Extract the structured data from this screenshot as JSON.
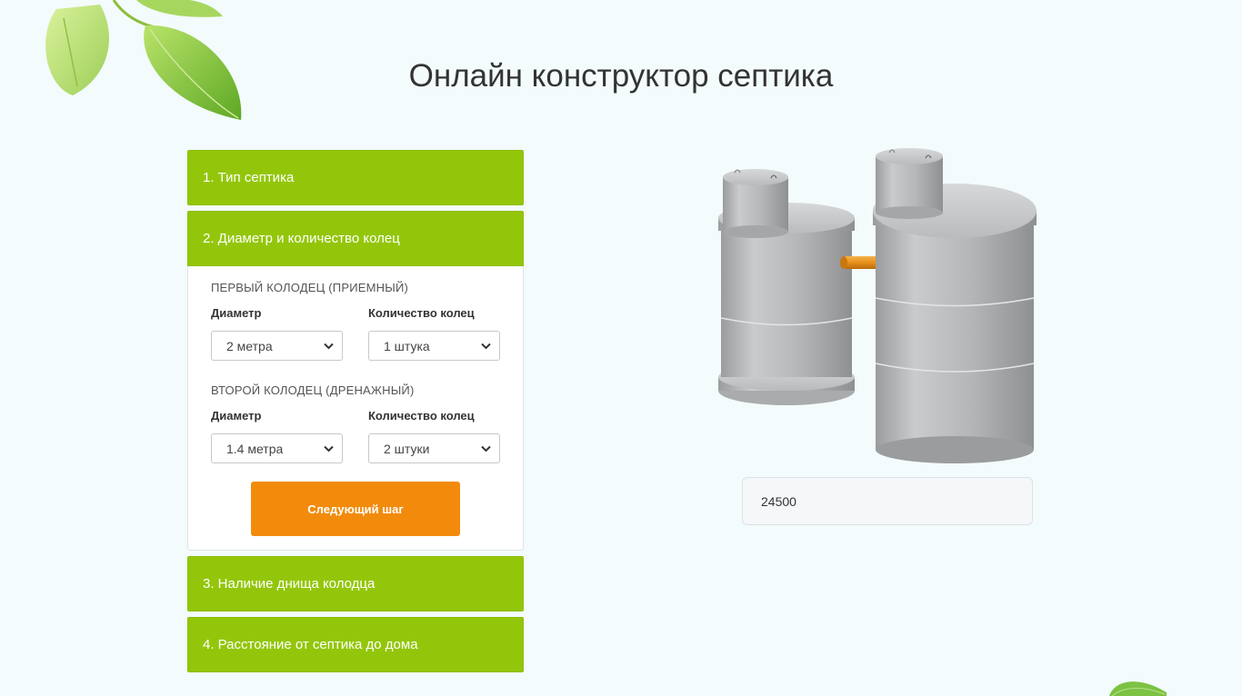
{
  "page": {
    "title": "Онлайн конструктор септика"
  },
  "steps": [
    {
      "label": "1. Тип септика"
    },
    {
      "label": "2. Диаметр и количество колец"
    },
    {
      "label": "3. Наличие днища колодца"
    },
    {
      "label": "4. Расстояние от септика до дома"
    }
  ],
  "wells": {
    "first": {
      "title": "ПЕРВЫЙ КОЛОДЕЦ (ПРИЕМНЫЙ)",
      "diameter_label": "Диаметр",
      "diameter_value": "2 метра",
      "rings_label": "Количество колец",
      "rings_value": "1 штука"
    },
    "second": {
      "title": "ВТОРОЙ КОЛОДЕЦ (ДРЕНАЖНЫЙ)",
      "diameter_label": "Диаметр",
      "diameter_value": "1.4 метра",
      "rings_label": "Количество колец",
      "rings_value": "2 штуки"
    }
  },
  "next_button": "Следующий шаг",
  "price": "24500",
  "colors": {
    "accent_green": "#93c60a",
    "button_orange": "#f28b0c",
    "background": "#f3fbfd"
  },
  "icons": {
    "leaves": "leaves-decoration",
    "select": "chevron-down-icon"
  }
}
